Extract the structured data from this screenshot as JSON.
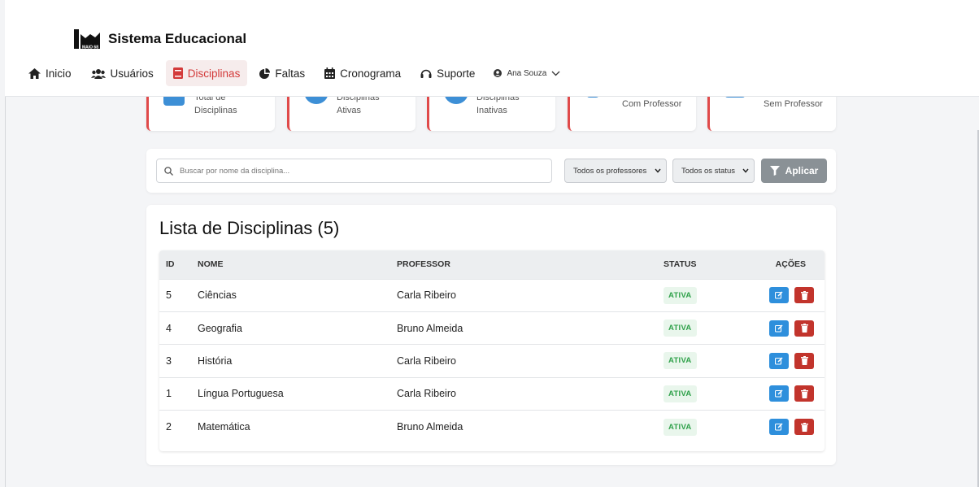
{
  "app": {
    "title": "Sistema Educacional",
    "logo_text": "MAIO 68"
  },
  "nav": {
    "items": [
      {
        "label": "Inicio",
        "icon": "home-icon",
        "active": false
      },
      {
        "label": "Usuários",
        "icon": "users-icon",
        "active": false
      },
      {
        "label": "Disciplinas",
        "icon": "book-icon",
        "active": true
      },
      {
        "label": "Faltas",
        "icon": "pie-chart-icon",
        "active": false
      },
      {
        "label": "Cronograma",
        "icon": "calendar-icon",
        "active": false
      },
      {
        "label": "Suporte",
        "icon": "headset-icon",
        "active": false
      }
    ],
    "user": {
      "name": "Ana Souza",
      "icon": "user-circle-icon"
    }
  },
  "stats": [
    {
      "label_line1": "Total de",
      "label_line2": "Disciplinas"
    },
    {
      "label_line1": "Disciplinas",
      "label_line2": "Ativas"
    },
    {
      "label_line1": "Disciplinas",
      "label_line2": "Inativas"
    },
    {
      "label_line1": "",
      "label_line2": "Com Professor"
    },
    {
      "label_line1": "",
      "label_line2": "Sem Professor"
    }
  ],
  "filters": {
    "search_placeholder": "Buscar por nome da disciplina...",
    "professor_select": "Todos os professores",
    "status_select": "Todos os status",
    "apply_label": "Aplicar"
  },
  "list": {
    "title": "Lista de Disciplinas (5)",
    "columns": {
      "id": "ID",
      "nome": "NOME",
      "professor": "PROFESSOR",
      "status": "STATUS",
      "acoes": "AÇÕES"
    },
    "rows": [
      {
        "id": "5",
        "nome": "Ciências",
        "professor": "Carla Ribeiro",
        "status": "ATIVA"
      },
      {
        "id": "4",
        "nome": "Geografia",
        "professor": "Bruno Almeida",
        "status": "ATIVA"
      },
      {
        "id": "3",
        "nome": "História",
        "professor": "Carla Ribeiro",
        "status": "ATIVA"
      },
      {
        "id": "1",
        "nome": "Língua Portuguesa",
        "professor": "Carla Ribeiro",
        "status": "ATIVA"
      },
      {
        "id": "2",
        "nome": "Matemática",
        "professor": "Bruno Almeida",
        "status": "ATIVA"
      }
    ]
  },
  "colors": {
    "accent_red": "#e04a4a",
    "active_nav_bg": "#f6ecec",
    "edit_blue": "#2e8fdc",
    "delete_red": "#c2342c",
    "status_green": "#2fa14a"
  }
}
